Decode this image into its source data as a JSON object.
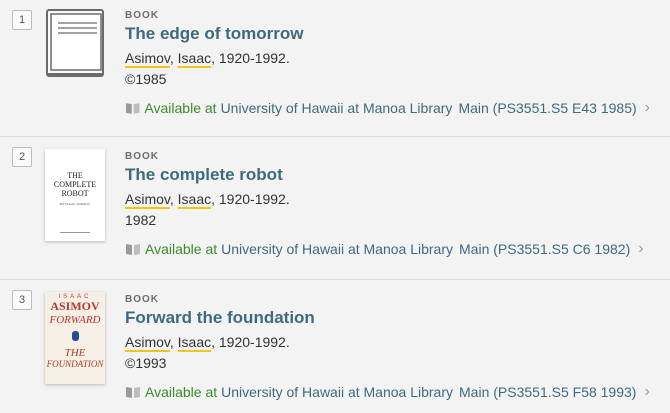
{
  "results": [
    {
      "number": "1",
      "type": "BOOK",
      "title": "The edge of tomorrow",
      "author_last": "Asimov",
      "author_first": "Isaac",
      "author_rest": ", 1920-1992.",
      "date": "©1985",
      "availability": "Available at",
      "library": "University of Hawaii at Manoa Library",
      "location": "Main (PS3551.S5 E43 1985)",
      "cover_icon": "book-placeholder-icon"
    },
    {
      "number": "2",
      "type": "BOOK",
      "title": "The complete robot",
      "author_last": "Asimov",
      "author_first": "Isaac",
      "author_rest": ", 1920-1992.",
      "date": "1982",
      "availability": "Available at",
      "library": "University of Hawaii at Manoa Library",
      "location": "Main (PS3551.S5 C6 1982)",
      "cover_text_top": "THE\nCOMPLETE\nROBOT",
      "cover_text_author": "BY ISAAC ASIMOV"
    },
    {
      "number": "3",
      "type": "BOOK",
      "title": "Forward the foundation",
      "author_last": "Asimov",
      "author_first": "Isaac",
      "author_rest": ", 1920-1992.",
      "date": "©1993",
      "availability": "Available at",
      "library": "University of Hawaii at Manoa Library",
      "location": "Main (PS3551.S5 F58 1993)",
      "cover_text_top": "ISAAC",
      "cover_text_mid": "ASIMOV",
      "cover_text_a": "FORWARD",
      "cover_text_b": "THE",
      "cover_text_c": "FOUNDATION"
    }
  ],
  "colors": {
    "link": "#3d6b7d",
    "available": "#3a8c2a",
    "highlight": "#f2c31b"
  }
}
